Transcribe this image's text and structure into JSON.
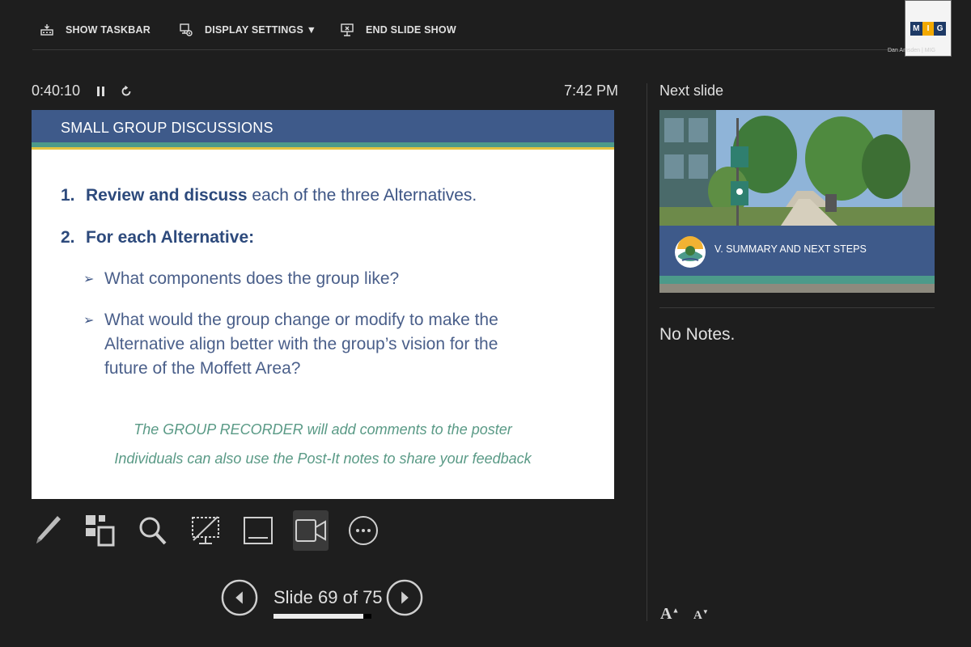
{
  "toolbar": {
    "show_taskbar": "SHOW TASKBAR",
    "display_settings": "DISPLAY SETTINGS ▼",
    "end_slide_show": "END SLIDE SHOW"
  },
  "webcam": {
    "logo_letters": [
      "M",
      "I",
      "G"
    ],
    "name": "Dan Amsden | MIG"
  },
  "timer": {
    "elapsed": "0:40:10",
    "clock": "7:42 PM"
  },
  "slide": {
    "header": "SMALL GROUP DISCUSSIONS",
    "item1_number": "1.",
    "item1_bold": "Review and discuss",
    "item1_rest": " each of the three Alternatives.",
    "item2_number": "2.",
    "item2_bold": "For each Alternative:",
    "sub1": "What components does the group like?",
    "sub2": "What would the group change or modify to make the Alternative align better with the group’s vision for the future of the Moffett Area?",
    "sub_arrow": "➢",
    "note1": "The GROUP RECORDER will add comments to the poster",
    "note2": "Individuals can also use the Post-It notes to share your feedback"
  },
  "navigation": {
    "counter": "Slide 69 of 75",
    "current": 69,
    "total": 75
  },
  "next_slide": {
    "label": "Next slide",
    "title": "V. SUMMARY AND NEXT STEPS"
  },
  "notes": {
    "text": "No Notes."
  },
  "font_controls": {
    "increase": "A",
    "decrease": "A"
  },
  "colors": {
    "slide_header": "#3e5a8a",
    "slide_teal": "#4c9a8a",
    "slide_gold": "#e3c340",
    "text_navy": "#2d4a7c",
    "note_green": "#5a9a86",
    "background": "#1e1e1e"
  }
}
